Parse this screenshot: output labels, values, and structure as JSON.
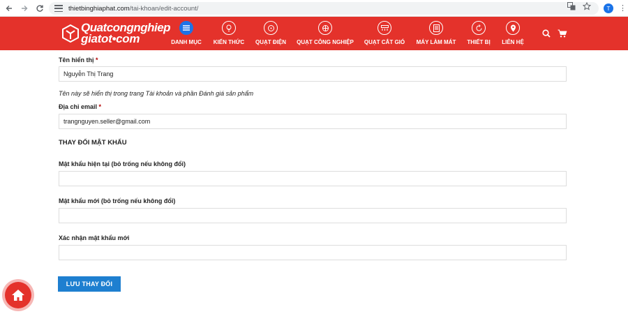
{
  "browser": {
    "url_domain": "thietbinghiaphat.com",
    "url_path": "/tai-khoan/edit-account/",
    "profile_initial": "T",
    "icons": [
      "back-icon",
      "forward-icon",
      "reload-icon",
      "tune-icon",
      "translate-icon",
      "star-icon",
      "profile-icon",
      "menu-dots-icon"
    ]
  },
  "site": {
    "logo_line1": "Quatcongnghiep",
    "logo_line2": "giatot•com",
    "brand_color": "#e4322b",
    "nav": [
      {
        "label": "DANH MỤC",
        "icon": "menu-icon"
      },
      {
        "label": "KIẾN THỨC",
        "icon": "lightbulb-icon"
      },
      {
        "label": "QUẠT ĐIỆN",
        "icon": "fan-icon"
      },
      {
        "label": "QUẠT CÔNG NGHIỆP",
        "icon": "industrial-fan-icon"
      },
      {
        "label": "QUẠT CẮT GIÓ",
        "icon": "air-curtain-icon"
      },
      {
        "label": "MÁY LÀM MÁT",
        "icon": "cooler-icon"
      },
      {
        "label": "THIẾT BỊ",
        "icon": "device-icon"
      },
      {
        "label": "LIÊN HỆ",
        "icon": "location-icon"
      }
    ]
  },
  "form": {
    "display_name_label": "Tên hiển thị",
    "required_mark": "*",
    "display_name_value": "Nguyễn Thị Trang",
    "display_name_hint": "Tên này sẽ hiển thị trong trang Tài khoản và phần Đánh giá sản phẩm",
    "email_label": "Địa chỉ email",
    "email_value": "trangnguyen.seller@gmail.com",
    "password_section": "THAY ĐỔI MẬT KHẨU",
    "current_password_label": "Mật khẩu hiện tại (bỏ trống nếu không đổi)",
    "new_password_label": "Mật khẩu mới (bỏ trống nếu không đổi)",
    "confirm_password_label": "Xác nhận mật khẩu mới",
    "save_label": "LƯU THAY ĐỔI",
    "button_color": "#1e7fd0"
  }
}
